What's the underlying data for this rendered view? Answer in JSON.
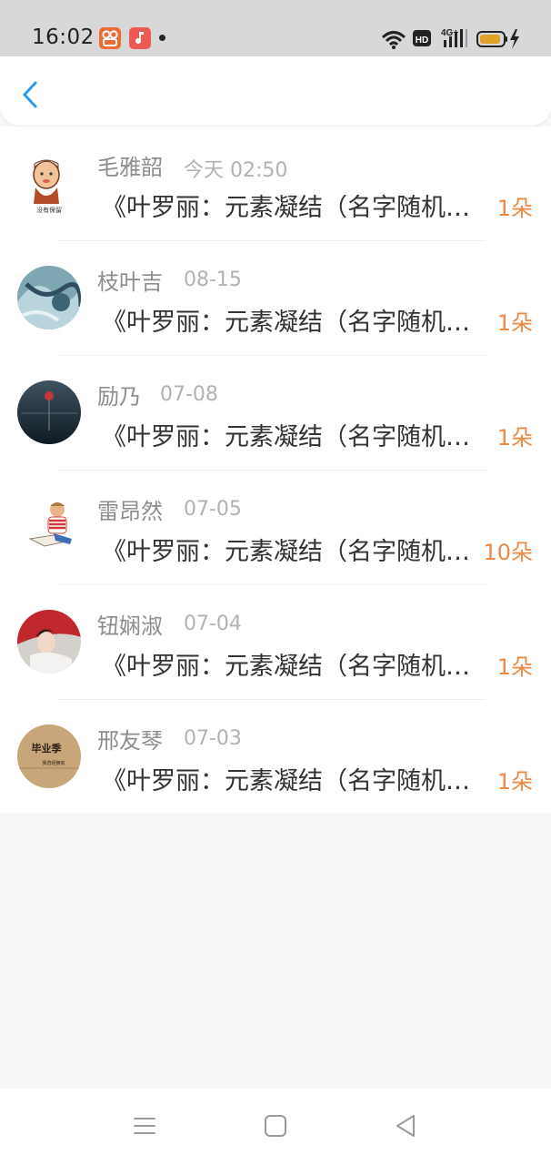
{
  "status_bar": {
    "time": "16:02",
    "hd_label": "HD",
    "network_label": "4G+",
    "icons": [
      "kuaishou-app-icon",
      "music-app-icon",
      "notification-dot",
      "wifi-icon",
      "hd-icon",
      "signal-icon",
      "battery-icon",
      "charging-icon"
    ]
  },
  "header": {
    "back_icon": "chevron-left-icon",
    "accent": "#2b9ae8"
  },
  "list": {
    "items": [
      {
        "name": "毛雅韶",
        "date": "今天 02:50",
        "title": "《叶罗丽：元素凝结（名字随机）》",
        "count": "1朵",
        "avatar": "cartoon-man-avatar"
      },
      {
        "name": "枝叶吉",
        "date": "08-15",
        "title": "《叶罗丽：元素凝结（名字随机）》",
        "count": "1朵",
        "avatar": "blue-abstract-avatar"
      },
      {
        "name": "励乃",
        "date": "07-08",
        "title": "《叶罗丽：元素凝结（名字随机）》",
        "count": "1朵",
        "avatar": "dark-rose-avatar"
      },
      {
        "name": "雷昂然",
        "date": "07-05",
        "title": "《叶罗丽：元素凝结（名字随机）》",
        "count": "10朵",
        "avatar": "reading-boy-avatar"
      },
      {
        "name": "钮娴淑",
        "date": "07-04",
        "title": "《叶罗丽：元素凝结（名字随机）》",
        "count": "1朵",
        "avatar": "girl-red-avatar"
      },
      {
        "name": "邢友琴",
        "date": "07-03",
        "title": "《叶罗丽：元素凝结（名字随机）》",
        "count": "1朵",
        "avatar": "graduation-avatar"
      }
    ]
  },
  "avatar_text": {
    "first_caption": "没有保留",
    "sixth_big": "毕业季",
    "sixth_small": "我曾经拥有"
  },
  "colors": {
    "count": "#ea8a45",
    "name": "#8d8d8d",
    "date": "#b2b2b2",
    "title": "#333333"
  },
  "navbar": {
    "icons": [
      "menu-icon",
      "home-square-icon",
      "back-triangle-icon"
    ]
  }
}
